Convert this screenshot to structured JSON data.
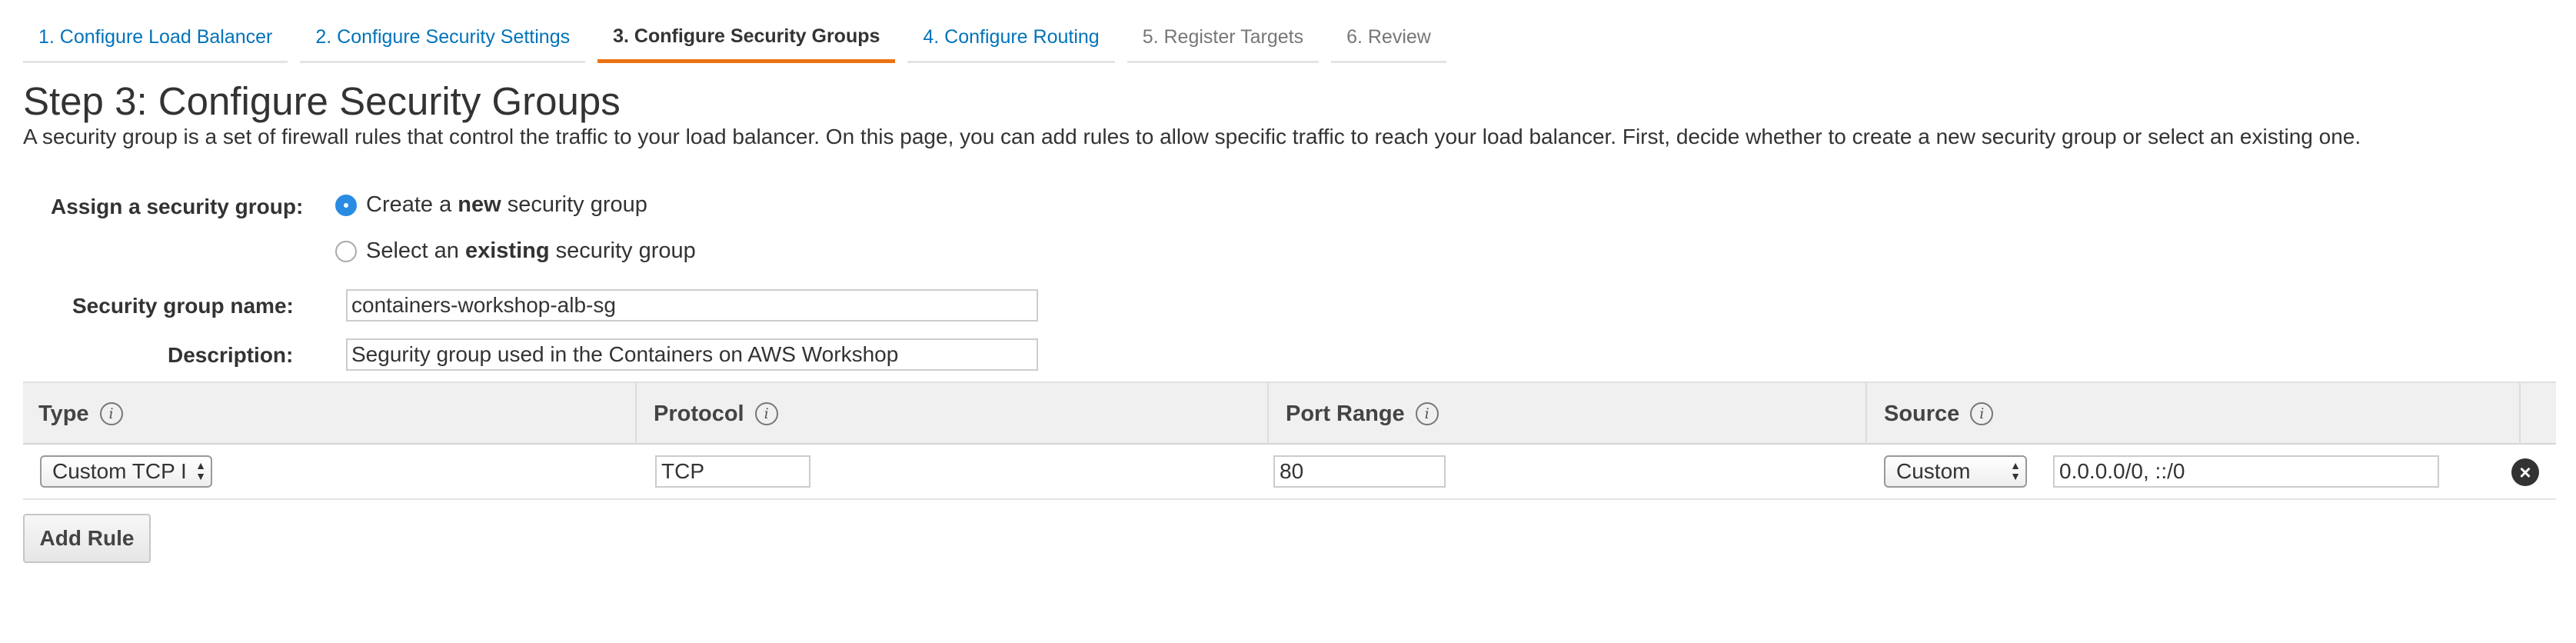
{
  "wizard": {
    "tabs": [
      {
        "label": "1. Configure Load Balancer",
        "state": "link"
      },
      {
        "label": "2. Configure Security Settings",
        "state": "link"
      },
      {
        "label": "3. Configure Security Groups",
        "state": "active"
      },
      {
        "label": "4. Configure Routing",
        "state": "link"
      },
      {
        "label": "5. Register Targets",
        "state": "future"
      },
      {
        "label": "6. Review",
        "state": "future"
      }
    ]
  },
  "page": {
    "title": "Step 3: Configure Security Groups",
    "description": "A security group is a set of firewall rules that control the traffic to your load balancer. On this page, you can add rules to allow specific traffic to reach your load balancer. First, decide whether to create a new security group or select an existing one."
  },
  "assign": {
    "label": "Assign a security group:",
    "option_new": {
      "prefix": "Create a ",
      "bold": "new",
      "suffix": " security group",
      "selected": true
    },
    "option_existing": {
      "prefix": "Select an ",
      "bold": "existing",
      "suffix": " security group",
      "selected": false
    }
  },
  "form": {
    "name_label": "Security group name:",
    "name_value": "containers-workshop-alb-sg",
    "description_label": "Description:",
    "description_value": "Segurity group used in the Containers on AWS Workshop"
  },
  "rules": {
    "columns": {
      "type": "Type",
      "protocol": "Protocol",
      "port_range": "Port Range",
      "source": "Source"
    },
    "rows": [
      {
        "type": "Custom TCP I",
        "protocol": "TCP",
        "port_range": "80",
        "source_type": "Custom",
        "source_value": "0.0.0.0/0, ::/0"
      }
    ],
    "add_rule_label": "Add Rule"
  },
  "colors": {
    "link": "#0073bb",
    "active_tab_underline": "#ec7211",
    "radio_selected": "#2a8be3"
  }
}
